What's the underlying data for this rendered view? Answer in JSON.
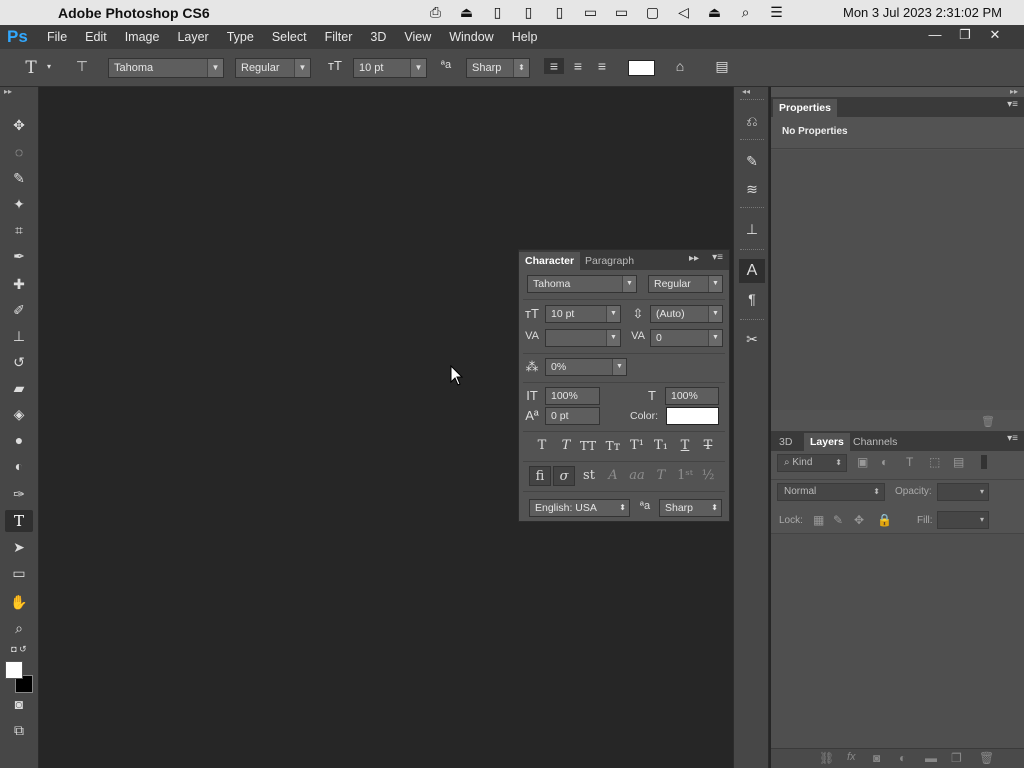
{
  "mac": {
    "app_name": "Adobe Photoshop CS6",
    "clock": "Mon 3 Jul 2023 2:31:02 PM",
    "status_icons": [
      "app-icon",
      "eject-icon",
      "memory-icon",
      "ssd-icon",
      "cpu-icon",
      "battery-icon",
      "display-icon",
      "cloud-icon",
      "monitor-icon",
      "mute-icon",
      "eject-icon",
      "spotlight-icon",
      "control-center-icon"
    ]
  },
  "app": {
    "logo": "Ps",
    "menu": [
      "File",
      "Edit",
      "Image",
      "Layer",
      "Type",
      "Select",
      "Filter",
      "3D",
      "View",
      "Window",
      "Help"
    ]
  },
  "options": {
    "font_family": "Tahoma",
    "font_style": "Regular",
    "font_size": "10 pt",
    "antialias": "Sharp",
    "text_color": "#ffffff"
  },
  "properties": {
    "tab": "Properties",
    "content": "No Properties"
  },
  "layers": {
    "tabs": [
      "3D",
      "Layers",
      "Channels"
    ],
    "filter": "Kind",
    "blend_mode": "Normal",
    "opacity_label": "Opacity:",
    "lock_label": "Lock:",
    "fill_label": "Fill:"
  },
  "character": {
    "tabs": [
      "Character",
      "Paragraph"
    ],
    "font_family": "Tahoma",
    "font_style": "Regular",
    "size": "10 pt",
    "leading": "(Auto)",
    "kerning": "",
    "tracking": "0",
    "tsume": "0%",
    "vscale": "100%",
    "hscale": "100%",
    "baseline": "0 pt",
    "color_label": "Color:",
    "color": "#ffffff",
    "language": "English: USA",
    "antialias": "Sharp"
  }
}
